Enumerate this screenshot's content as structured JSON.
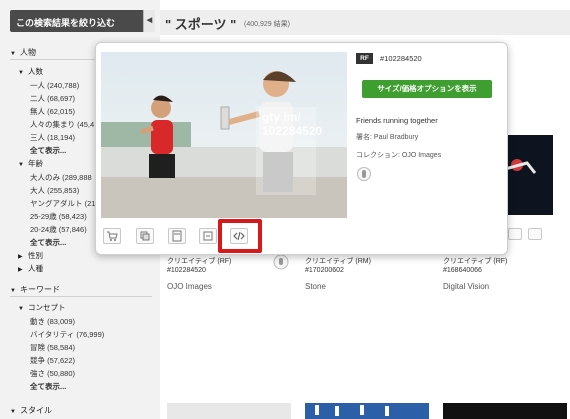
{
  "sidebar": {
    "header": "この検索結果を絞り込む",
    "collapse_icon": "chevron-left-icon",
    "sections": {
      "people": "人物",
      "people_count_title": "人数",
      "people_count_items": [
        "一人 (240,788)",
        "二人 (68,697)",
        "無人 (62,015)",
        "人々の集まり (45,4",
        "三人 (18,194)"
      ],
      "people_count_more": "全て表示...",
      "age_title": "年齢",
      "age_items": [
        "大人のみ (289,888",
        "大人 (255,853)",
        "ヤングアダルト (21",
        "25-29歳 (58,423)",
        "20-24歳 (57,846)"
      ],
      "age_more": "全て表示...",
      "gender": "性別",
      "race": "人種",
      "keyword": "キーワード",
      "concept_title": "コンセプト",
      "concept_items": [
        "動き (83,009)",
        "バイタリティ (76,999)",
        "冒険 (58,584)",
        "競争 (57,622)",
        "強さ (50,880)"
      ],
      "concept_more": "全て表示...",
      "style": "スタイル"
    }
  },
  "main": {
    "title": "\" スポーツ \"",
    "count": "(400,929 結果)"
  },
  "popup": {
    "badge": "RF",
    "image_id": "#102284520",
    "button_label": "サイズ/価格オプションを表示",
    "caption": "Friends running together",
    "credit_label": "署名:",
    "credit_value": "Paul Bradbury",
    "collection_label": "コレクション:",
    "collection_value": "OJO Images",
    "watermark_line1": "gty im/",
    "watermark_line2": "102284520",
    "tools": [
      "cart-add-icon",
      "copy-icon",
      "calculator-icon",
      "resize-icon",
      "embed-code-icon"
    ]
  },
  "results": [
    {
      "type": "クリエイティブ (RF)",
      "id": "#102284520",
      "source": "OJO Images"
    },
    {
      "type": "クリエイティブ (RM)",
      "id": "#170200602",
      "source": "Stone"
    },
    {
      "type": "クリエイティブ (RF)",
      "id": "#168640066",
      "source": "Digital Vision"
    }
  ],
  "colors": {
    "accent_green": "#3e9e2f",
    "highlight_red": "#d7191c",
    "sidebar_header": "#4a4a4a"
  }
}
